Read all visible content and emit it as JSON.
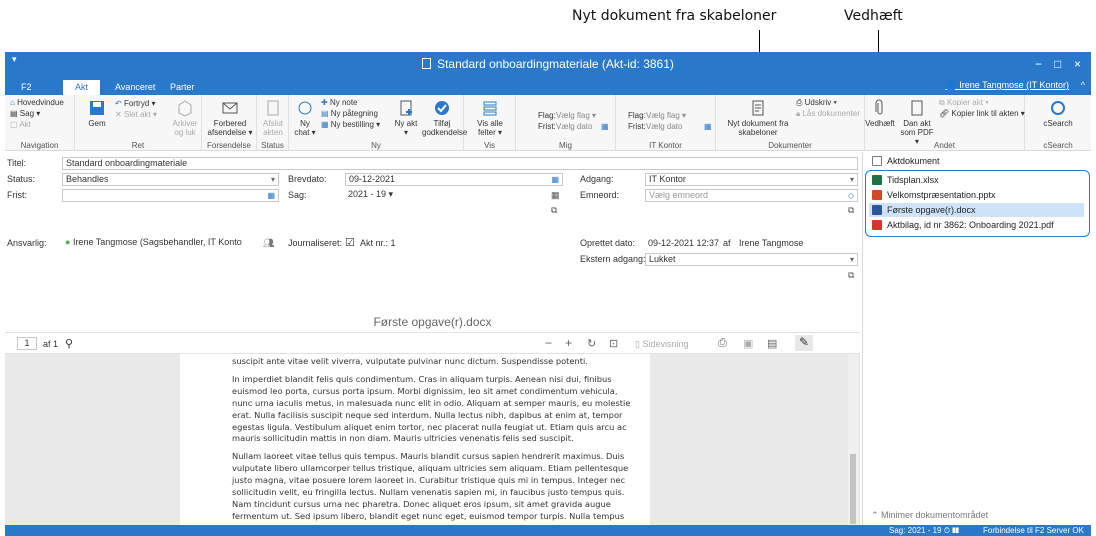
{
  "callouts": {
    "nyt_dokument": "Nyt dokument fra skabeloner",
    "vedhaeft": "Vedhæft"
  },
  "window": {
    "title": "Standard onboardingmateriale (Akt-id: 3861)",
    "app_badge": "F2",
    "minimize": "−",
    "maximize": "□",
    "close": "×"
  },
  "tabs": [
    "F2",
    "Akt",
    "Avanceret",
    "Parter"
  ],
  "user": "Irene Tangmose (IT Kontor)",
  "ribbon": {
    "navigation": {
      "label": "Navigation",
      "items": [
        "Hovedvindue",
        "Sag",
        "Akt"
      ]
    },
    "ret": {
      "label": "Ret",
      "gem": "Gem",
      "fortryd": "Fortryd",
      "slet": "Slet akt",
      "arkiver": "Arkiver og luk"
    },
    "forsendelse": {
      "label": "Forsendelse",
      "forbered": "Forbered afsendelse"
    },
    "status": {
      "label": "Status",
      "afslut": "Afslut akten"
    },
    "ny": {
      "label": "Ny",
      "chat": "Ny chat",
      "note": "Ny note",
      "paategning": "Ny påtegning",
      "bestilling": "Ny bestilling",
      "akt": "Ny akt",
      "godkendelse": "Tilføj godkendelse"
    },
    "vis": {
      "label": "Vis",
      "alle": "Vis alle felter"
    },
    "mig": {
      "label": "Mig",
      "flag": "Flag:",
      "flag_val": "Vælg flag",
      "frist": "Frist:",
      "frist_val": "Vælg dato"
    },
    "it_kontor": {
      "label": "IT Kontor",
      "flag": "Flag:",
      "flag_val": "Vælg flag",
      "frist": "Frist:",
      "frist_val": "Vælg dato"
    },
    "dokumenter": {
      "label": "Dokumenter",
      "nyt": "Nyt dokument fra skabeloner",
      "udskriv": "Udskriv",
      "laas": "Lås dokumenter"
    },
    "andet": {
      "label": "Andet",
      "vedhaeft": "Vedhæft",
      "dan_akt": "Dan akt som PDF",
      "kopier_akt": "Kopier akt",
      "kopier_link": "Kopier link til akten"
    },
    "csearch": {
      "label": "cSearch",
      "btn": "cSearch"
    }
  },
  "form": {
    "titel_lbl": "Titel:",
    "titel": "Standard onboardingmateriale",
    "status_lbl": "Status:",
    "status": "Behandles",
    "frist_lbl": "Frist:",
    "brevdato_lbl": "Brevdato:",
    "brevdato": "09-12-2021",
    "sag_lbl": "Sag:",
    "sag": "2021 - 19",
    "adgang_lbl": "Adgang:",
    "adgang": "IT Kontor",
    "emneord_lbl": "Emneord:",
    "emneord_ph": "Vælg emneord",
    "ansvarlig_lbl": "Ansvarlig:",
    "ansvarlig": "Irene Tangmose (Sagsbehandler, IT Kontor)",
    "journaliseret_lbl": "Journaliseret:",
    "akt_nr": "Akt nr.: 1",
    "oprettet_lbl": "Oprettet dato:",
    "oprettet": "09-12-2021 12:37",
    "af": "af",
    "oprettet_af": "Irene Tangmose",
    "ekstern_lbl": "Ekstern adgang:",
    "ekstern": "Lukket"
  },
  "viewer": {
    "doc_title": "Første opgave(r).docx",
    "page": "1",
    "of": "af 1",
    "sidevisning": "Sidevisning",
    "paragraphs": [
      "suscipit ante vitae velit viverra, vulputate pulvinar nunc dictum. Suspendisse potenti.",
      "In imperdiet blandit felis quis condimentum. Cras in aliquam turpis. Aenean nisi dui, finibus euismod leo porta, cursus porta ipsum. Morbi dignissim, leo sit amet condimentum vehicula, nunc urna iaculis metus, in malesuada nunc elit in odio. Aliquam at semper mauris, eu molestie erat. Nulla facilisis suscipit neque sed interdum. Nulla lectus nibh, dapibus at enim at, tempor egestas ligula. Vestibulum aliquet enim tortor, nec placerat nulla feugiat ut. Etiam quis arcu ac mauris sollicitudin mattis in non diam. Mauris ultricies venenatis felis sed suscipit.",
      "Nullam laoreet vitae tellus quis tempus. Mauris blandit cursus sapien hendrerit maximus. Duis vulputate libero ullamcorper tellus tristique, aliquam ultricies sem aliquam. Etiam pellentesque justo magna, vitae posuere lorem laoreet in. Curabitur tristique quis mi in tempus. Integer nec sollicitudin velit, eu fringilla lectus. Nullam venenatis sapien mi, in faucibus justo tempus quis. Nam tincidunt cursus urna nec pharetra. Donec aliquet eros ipsum, sit amet gravida augue fermentum ut. Sed ipsum libero, blandit eget nunc eget, euismod tempor turpis. Nulla tempus lectus varius fringilla posuere. Vivamus sagittis, erat vitae blandit tincidunt, odio tortor placerat elit, eu accumsan leo lectus quis nisi. Aliquam nisi leo, dignissim nec risus a, vehicula venenatis orci."
    ]
  },
  "sidebar": {
    "aktdokument": "Aktdokument",
    "attachments": [
      {
        "name": "Tidsplan.xlsx",
        "color": "#1e7145"
      },
      {
        "name": "Velkomstpræsentation.pptx",
        "color": "#d24726"
      },
      {
        "name": "Første opgave(r).docx",
        "color": "#2b579a"
      },
      {
        "name": "Aktbilag, id nr 3862: Onboarding 2021.pdf",
        "color": "#d9342b"
      }
    ],
    "minimer": "Minimer dokumentområdet"
  },
  "statusbar": {
    "sag": "Sag: 2021 - 19",
    "conn": "Forbindelse til F2 Server OK"
  },
  "colors": {
    "accent": "#2a78c9",
    "selected": "#cde3f7",
    "highlight_border": "#2a78c9"
  }
}
